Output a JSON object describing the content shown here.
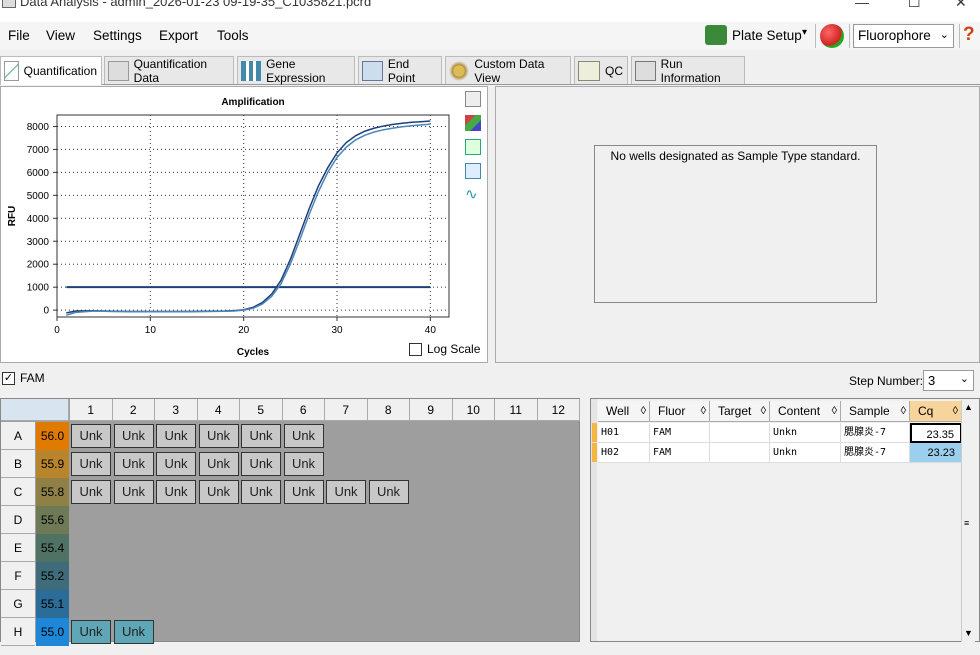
{
  "window": {
    "title": "Data Analysis - admin_2026-01-23 09-19-35_C1035821.pcrd"
  },
  "menu": [
    "File",
    "View",
    "Settings",
    "Export",
    "Tools"
  ],
  "toolbar": {
    "plate_setup": "Plate Setup",
    "fluorophore": "Fluorophore"
  },
  "tabs": [
    {
      "label": "Quantification",
      "active": true
    },
    {
      "label": "Quantification Data"
    },
    {
      "label": "Gene Expression"
    },
    {
      "label": "End Point"
    },
    {
      "label": "Custom Data View"
    },
    {
      "label": "QC"
    },
    {
      "label": "Run Information"
    }
  ],
  "chart_data": {
    "type": "line",
    "title": "Amplification",
    "xlabel": "Cycles",
    "ylabel": "RFU",
    "xlim": [
      0,
      42
    ],
    "ylim": [
      -300,
      8500
    ],
    "xticks": [
      0,
      10,
      20,
      30,
      40
    ],
    "yticks": [
      0,
      1000,
      2000,
      3000,
      4000,
      5000,
      6000,
      7000,
      8000
    ],
    "grid": true,
    "threshold": 1000,
    "series": [
      {
        "x": [
          1,
          2,
          4,
          6,
          8,
          10,
          12,
          14,
          16,
          18,
          19,
          20,
          21,
          22,
          23,
          24,
          25,
          26,
          27,
          28,
          29,
          30,
          31,
          32,
          33,
          34,
          35,
          36,
          37,
          38,
          39,
          40
        ],
        "y": [
          -120,
          -40,
          -30,
          -50,
          -60,
          -60,
          -60,
          -60,
          -50,
          -40,
          -20,
          20,
          120,
          330,
          700,
          1300,
          2200,
          3300,
          4400,
          5400,
          6200,
          6850,
          7300,
          7600,
          7800,
          7930,
          8020,
          8090,
          8140,
          8180,
          8210,
          8240
        ],
        "color": "#1f3f7a"
      },
      {
        "x": [
          1,
          2,
          4,
          6,
          8,
          10,
          12,
          14,
          16,
          18,
          19,
          20,
          21,
          22,
          23,
          24,
          25,
          26,
          27,
          28,
          29,
          30,
          31,
          32,
          33,
          34,
          35,
          36,
          37,
          38,
          39,
          40
        ],
        "y": [
          -220,
          -100,
          -40,
          -60,
          -70,
          -70,
          -70,
          -70,
          -60,
          -50,
          -40,
          0,
          80,
          260,
          600,
          1150,
          2000,
          3050,
          4150,
          5150,
          6000,
          6650,
          7100,
          7420,
          7620,
          7760,
          7860,
          7930,
          7990,
          8030,
          8070,
          8100
        ],
        "color": "#4a86b8"
      }
    ]
  },
  "chart_icons": [
    "copy-icon",
    "color-icon",
    "export-icon",
    "zoom-icon",
    "curve-icon"
  ],
  "log_scale": {
    "label": "Log Scale",
    "checked": false
  },
  "standard_msg": "No wells designated as Sample Type standard.",
  "fam": {
    "label": "FAM",
    "checked": true
  },
  "step": {
    "label": "Step Number:",
    "value": "3"
  },
  "plate": {
    "cols": [
      "1",
      "2",
      "3",
      "4",
      "5",
      "6",
      "7",
      "8",
      "9",
      "10",
      "11",
      "12"
    ],
    "rows": [
      {
        "label": "A",
        "temp": "56.0",
        "color": "#e07b00",
        "wells": [
          "Unk",
          "Unk",
          "Unk",
          "Unk",
          "Unk",
          "Unk"
        ]
      },
      {
        "label": "B",
        "temp": "55.9",
        "color": "#b8852c",
        "wells": [
          "Unk",
          "Unk",
          "Unk",
          "Unk",
          "Unk",
          "Unk"
        ]
      },
      {
        "label": "C",
        "temp": "55.8",
        "color": "#8f8046",
        "wells": [
          "Unk",
          "Unk",
          "Unk",
          "Unk",
          "Unk",
          "Unk",
          "Unk",
          "Unk"
        ]
      },
      {
        "label": "D",
        "temp": "55.6",
        "color": "#6e7a55",
        "wells": []
      },
      {
        "label": "E",
        "temp": "55.4",
        "color": "#4f7265",
        "wells": []
      },
      {
        "label": "F",
        "temp": "55.2",
        "color": "#3e6c7b",
        "wells": []
      },
      {
        "label": "G",
        "temp": "55.1",
        "color": "#2c6c99",
        "wells": []
      },
      {
        "label": "H",
        "temp": "55.0",
        "color": "#1f87d8",
        "wells": [
          "Unk",
          "Unk"
        ]
      }
    ]
  },
  "table": {
    "headers": [
      "Well",
      "Fluor",
      "Target",
      "Content",
      "Sample",
      "Cq"
    ],
    "rows": [
      {
        "well": "H01",
        "fluor": "FAM",
        "target": "",
        "content": "Unkn",
        "sample": "腮腺炎-7",
        "cq": "23.35"
      },
      {
        "well": "H02",
        "fluor": "FAM",
        "target": "",
        "content": "Unkn",
        "sample": "腮腺炎-7",
        "cq": "23.23"
      }
    ]
  }
}
